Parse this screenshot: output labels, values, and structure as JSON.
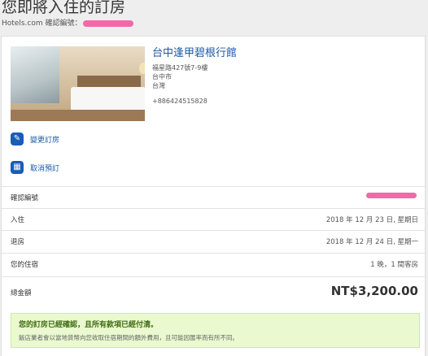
{
  "page": {
    "title": "您即將入住的訂房",
    "confirmation_line": "Hotels.com 確認編號："
  },
  "hotel": {
    "name": "台中逢甲碧根行館",
    "address_line1": "福星路427號7-9樓",
    "address_line2": "台中市",
    "address_line3": "台灣",
    "phone": "+886424515828"
  },
  "actions": {
    "modify_label": "變更訂房",
    "modify_icon": "edit-icon",
    "cancel_label": "取消預訂",
    "cancel_icon": "calendar-icon"
  },
  "details": {
    "confirmation_label": "確認編號",
    "checkin_label": "入住",
    "checkin_value": "2018 年 12 月 23 日, 星期日",
    "checkout_label": "退房",
    "checkout_value": "2018 年 12 月 24 日, 星期一",
    "stay_label": "您的住宿",
    "stay_value": "1 晚，1 間客房",
    "total_label": "總金額",
    "total_value": "NT$3,200.00"
  },
  "notice": {
    "title": "您的訂房已經確認，且所有款項已經付清。",
    "body": "飯店業者會以當地貨幣向您收取住宿期間的額外費用，且可能因匯率而有所不同。"
  },
  "colors": {
    "link": "#1b5aa6",
    "button": "#1a5cb8",
    "redaction": "#f06aa8",
    "notice_bg": "#eaf9cf"
  }
}
